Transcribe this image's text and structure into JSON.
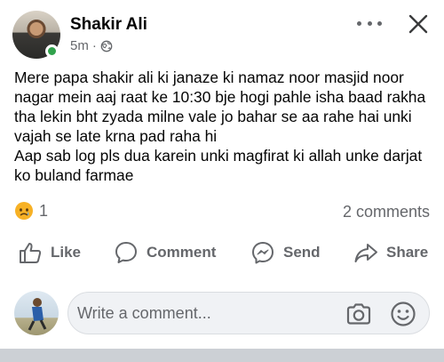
{
  "post": {
    "author": "Shakir Ali",
    "time": "5m",
    "separator": "·",
    "text": "Mere papa shakir ali ki janaze ki namaz noor masjid noor nagar mein aaj raat ke 10:30 bje hogi pahle isha baad rakha tha lekin bht zyada milne vale jo bahar se aa rahe hai unki vajah se late krna pad raha hi\nAap sab log pls dua karein unki magfirat ki allah unke darjat ko buland farmae"
  },
  "reactions": {
    "count": "1",
    "icon": "sad-emoji"
  },
  "comments": {
    "count_label": "2 comments"
  },
  "actions": {
    "like": "Like",
    "comment": "Comment",
    "send": "Send",
    "share": "Share"
  },
  "composer": {
    "placeholder": "Write a comment..."
  },
  "colors": {
    "online": "#31a24c",
    "secondary_text": "#65676b",
    "input_bg": "#f0f2f5"
  }
}
